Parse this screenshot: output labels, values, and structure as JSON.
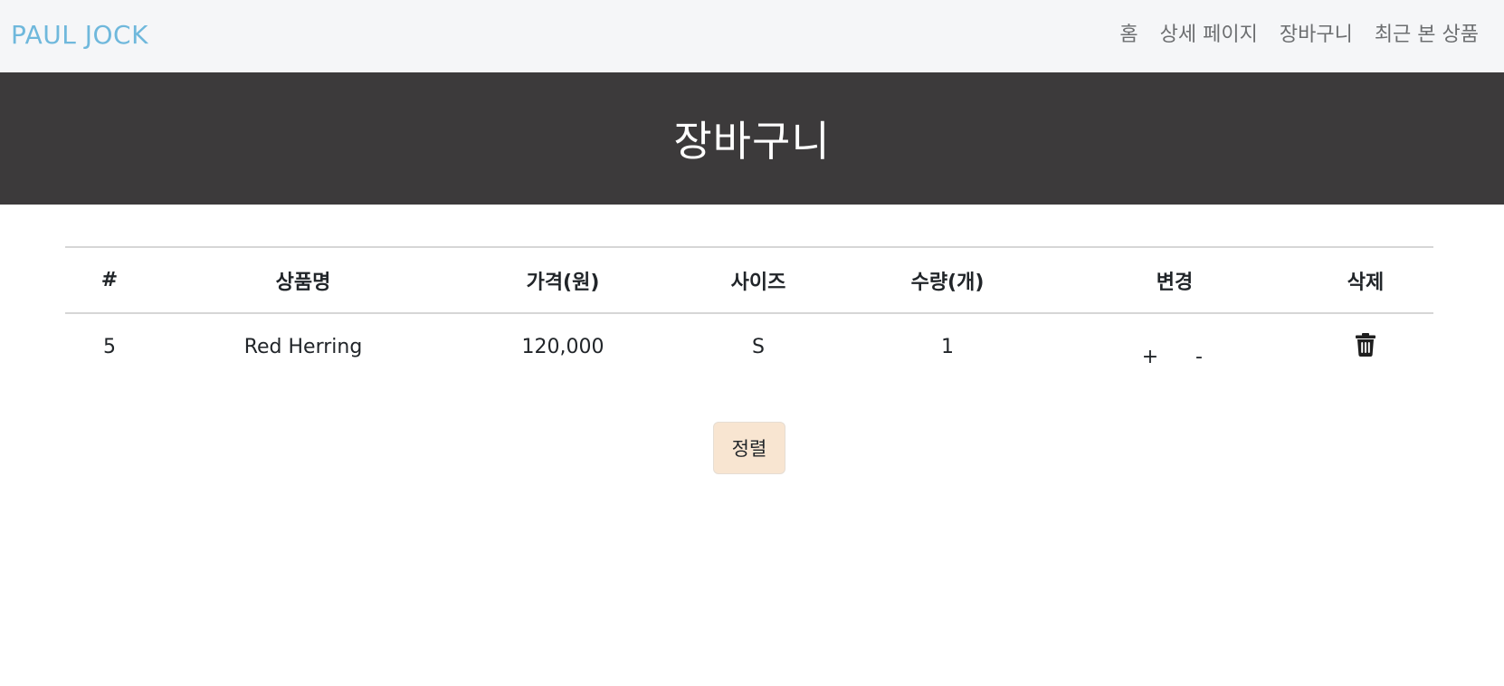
{
  "navbar": {
    "brand": "PAUL JOCK",
    "links": [
      "홈",
      "상세 페이지",
      "장바구니",
      "최근 본 상품"
    ]
  },
  "hero": {
    "title": "장바구니"
  },
  "cart_table": {
    "headers": [
      "#",
      "상품명",
      "가격(원)",
      "사이즈",
      "수량(개)",
      "변경",
      "삭제"
    ],
    "rows": [
      {
        "id": "5",
        "name": "Red Herring",
        "price": "120,000",
        "size": "S",
        "quantity": "1",
        "increase_label": "+",
        "decrease_label": "-",
        "delete_icon": "trash-icon"
      }
    ]
  },
  "sort_button": {
    "label": "정렬"
  },
  "colors": {
    "brand": "#6fb8dc",
    "navbar_bg": "#f5f6f8",
    "hero_bg": "#3c3a3b",
    "sort_button_bg": "#f8e5d1"
  }
}
